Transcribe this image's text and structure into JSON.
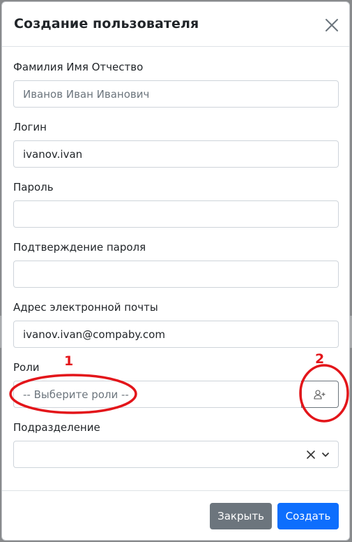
{
  "modal": {
    "title": "Создание пользователя"
  },
  "form": {
    "full_name": {
      "label": "Фамилия Имя Отчество",
      "placeholder": "Иванов Иван Иванович",
      "value": ""
    },
    "login": {
      "label": "Логин",
      "value": "ivanov.ivan"
    },
    "password": {
      "label": "Пароль",
      "value": ""
    },
    "password_confirm": {
      "label": "Подтверждение пароля",
      "value": ""
    },
    "email": {
      "label": "Адрес электронной почты",
      "value": "ivanov.ivan@compaby.com"
    },
    "roles": {
      "label": "Роли",
      "placeholder": "-- Выберите роли --"
    },
    "department": {
      "label": "Подразделение",
      "value": ""
    }
  },
  "footer": {
    "close_label": "Закрыть",
    "create_label": "Создать"
  },
  "annotations": {
    "marker_1": "1",
    "marker_2": "2"
  },
  "icons": {
    "close": "close-icon",
    "add_user": "user-plus-icon",
    "clear": "clear-x-icon",
    "dropdown": "chevron-down-icon"
  },
  "colors": {
    "primary": "#0d6efd",
    "secondary": "#6c757d",
    "annotation": "#e3151a"
  }
}
